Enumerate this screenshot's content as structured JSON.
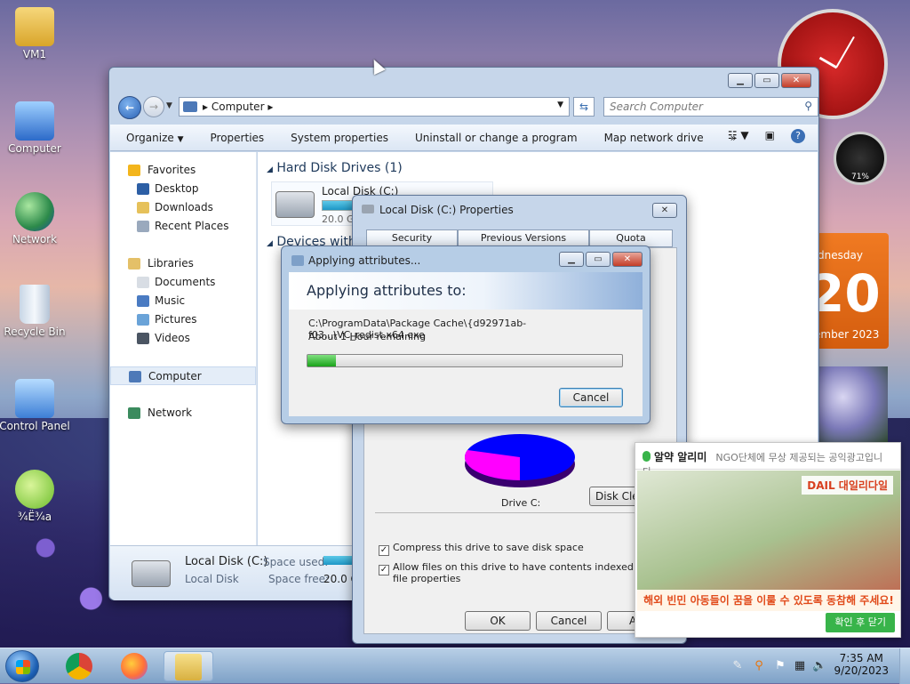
{
  "desktop": {
    "icons": [
      {
        "label": "VM1",
        "icon": "user-folder-icon"
      },
      {
        "label": "Computer",
        "icon": "computer-icon"
      },
      {
        "label": "Network",
        "icon": "network-globe-icon"
      },
      {
        "label": "Recycle Bin",
        "icon": "recycle-bin-icon"
      },
      {
        "label": "Control Panel",
        "icon": "control-panel-icon"
      },
      {
        "label": "¾Ë¾a",
        "icon": "frog-app-icon"
      }
    ]
  },
  "explorer": {
    "address": "Computer",
    "search_placeholder": "Search Computer",
    "toolbar": [
      "Organize",
      "Properties",
      "System properties",
      "Uninstall or change a program",
      "Map network drive"
    ],
    "overflow": "»",
    "nav": {
      "favorites_label": "Favorites",
      "favorites": [
        "Desktop",
        "Downloads",
        "Recent Places"
      ],
      "libraries_label": "Libraries",
      "libraries": [
        "Documents",
        "Music",
        "Pictures",
        "Videos"
      ],
      "computer_label": "Computer",
      "network_label": "Network"
    },
    "section_hdd": "Hard Disk Drives (1)",
    "section_devices": "Devices with",
    "drive": {
      "name": "Local Disk (C:)",
      "free": "20.0 GB",
      "used_fraction": 0.3
    },
    "details": {
      "name": "Local Disk (C:)",
      "type": "Local Disk",
      "used_label": "Space used:",
      "free_label": "Space free:",
      "free_value": "20.0 GB"
    }
  },
  "properties": {
    "title": "Local Disk (C:) Properties",
    "tabs": [
      "Security",
      "Previous Versions",
      "Quota"
    ],
    "drive_label": "Drive C:",
    "disk_cleanup": "Disk Clea",
    "compress": "Compress this drive to save disk space",
    "index_line1": "Allow files on this drive to have contents indexed in additio",
    "index_line2": "file properties",
    "ok": "OK",
    "cancel": "Cancel",
    "apply": "A",
    "pie": {
      "used_color": "#ff00ff",
      "free_color": "#0000ff"
    }
  },
  "apply_dialog": {
    "title": "Applying attributes...",
    "heading": "Applying attributes to:",
    "path": "C:\\ProgramData\\Package Cache\\{d92971ab-f03...\\VC_redist.x64.exe",
    "remaining": "About 1 Hour remaining",
    "progress": 0.09,
    "cancel": "Cancel"
  },
  "ad": {
    "title": "알약 알리미",
    "subtitle": "NGO단체에 무상 제공되는 공익광고입니다.",
    "logo": "DAIL 대일리다일",
    "caption": "해외 빈민 아동들이 꿈을 이룰 수 있도록 동참해 주세요!",
    "close": "확인 후 닫기"
  },
  "gadgets": {
    "cpu_percent": "71%",
    "calendar_day": "dnesday",
    "calendar_date": "20",
    "calendar_month": "ember 2023"
  },
  "taskbar": {
    "apps": [
      "chrome-icon",
      "firefox-icon",
      "explorer-icon"
    ],
    "time": "7:35 AM",
    "date": "9/20/2023"
  },
  "colors": {
    "accent": "#2a62b5",
    "progress": "#1aa31a",
    "ad_close": "#38b44a"
  }
}
